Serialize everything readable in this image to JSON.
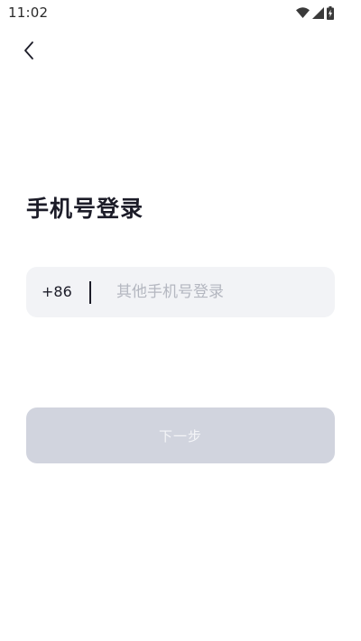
{
  "status_bar": {
    "time": "11:02",
    "icons": [
      "wifi-icon",
      "cellular-signal-icon",
      "battery-charging-icon"
    ]
  },
  "nav": {
    "back_icon": "chevron-left-icon"
  },
  "title": "手机号登录",
  "phone_field": {
    "country_code": "+86",
    "placeholder": "其他手机号登录",
    "value": ""
  },
  "next_button": {
    "label": "下一步",
    "enabled": false
  },
  "colors": {
    "title_text": "#1c1c28",
    "field_background": "#f2f3f6",
    "placeholder_text": "#b4b7c0",
    "button_disabled_background": "#d1d4de",
    "button_disabled_text": "#f4f5f8"
  }
}
